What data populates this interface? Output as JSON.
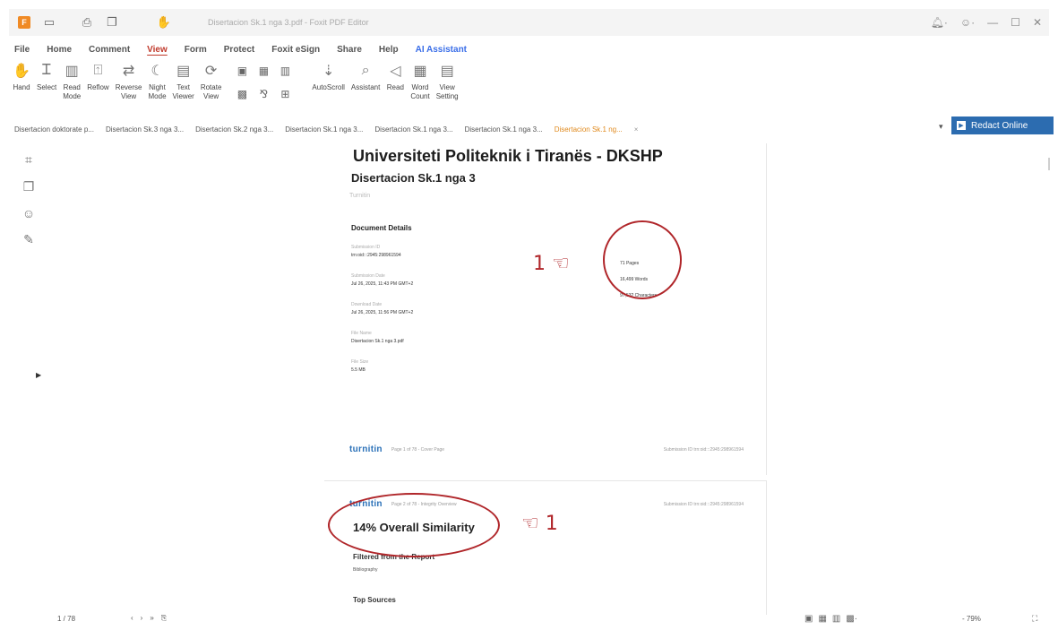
{
  "window": {
    "title": "Disertacion Sk.1 nga 3.pdf - Foxit PDF Editor"
  },
  "menu": [
    {
      "label": "File"
    },
    {
      "label": "Home"
    },
    {
      "label": "Comment"
    },
    {
      "label": "View",
      "active": true
    },
    {
      "label": "Form"
    },
    {
      "label": "Protect"
    },
    {
      "label": "Foxit eSign"
    },
    {
      "label": "Share"
    },
    {
      "label": "Help"
    },
    {
      "label": "AI Assistant"
    }
  ],
  "toolbar": {
    "hand": "Hand",
    "select": "Select",
    "read_mode": "Read\nMode",
    "reflow": "Reflow",
    "reverse_view": "Reverse\nView",
    "night_mode": "Night\nMode",
    "text_viewer": "Text\nViewer",
    "rotate_view": "Rotate\nView",
    "autoscroll": "AutoScroll",
    "assistant": "Assistant",
    "read": "Read",
    "word_count": "Word\nCount",
    "view_setting": "View\nSetting"
  },
  "tabs": [
    {
      "label": "Disertacion doktorate p..."
    },
    {
      "label": "Disertacion Sk.3 nga 3..."
    },
    {
      "label": "Disertacion Sk.2 nga 3..."
    },
    {
      "label": "Disertacion Sk.1 nga 3..."
    },
    {
      "label": "Disertacion Sk.1 nga 3..."
    },
    {
      "label": "Disertacion Sk.1 nga 3..."
    },
    {
      "label": "Disertacion Sk.1 ng...",
      "active": true
    }
  ],
  "redact": {
    "label": "Redact Online"
  },
  "document": {
    "university": "Universiteti Politeknik i Tiranës - DKSHP",
    "dissertation": "Disertacion Sk.1 nga 3",
    "subtitle": "Turnitin",
    "details_heading": "Document Details",
    "details": [
      {
        "label": "Submission ID",
        "value": "trn:oid:::2945:298961594"
      },
      {
        "label": "Submission Date",
        "value": "Jul 26, 2025, 11:43 PM GMT+2"
      },
      {
        "label": "Download Date",
        "value": "Jul 26, 2025, 11:56 PM GMT+2"
      },
      {
        "label": "File Name",
        "value": "Disertacion Sk.1 nga 3.pdf"
      },
      {
        "label": "File Size",
        "value": "5.5 MB"
      }
    ],
    "stats": [
      "71 Pages",
      "16,499 Words",
      "97,532 Characters"
    ],
    "turnitin_logo": "turnitin",
    "page1_footer": "Page 1 of 78 - Cover Page",
    "page1_footer_right": "Submission ID trn:oid:::2945:298961594",
    "page2_footer": "Page 2 of 78 - Integrity Overview",
    "page2_footer_right": "Submission ID trn:oid:::2945:298961594",
    "overall_similarity": "14% Overall Similarity",
    "filtered_heading": "Filtered from the Report",
    "filtered_item": "Bibliography",
    "top_sources": "Top Sources"
  },
  "annotations": {
    "note1": "1",
    "note2": "1"
  },
  "status": {
    "page_indicator": "1 / 78",
    "zoom": "79%"
  }
}
